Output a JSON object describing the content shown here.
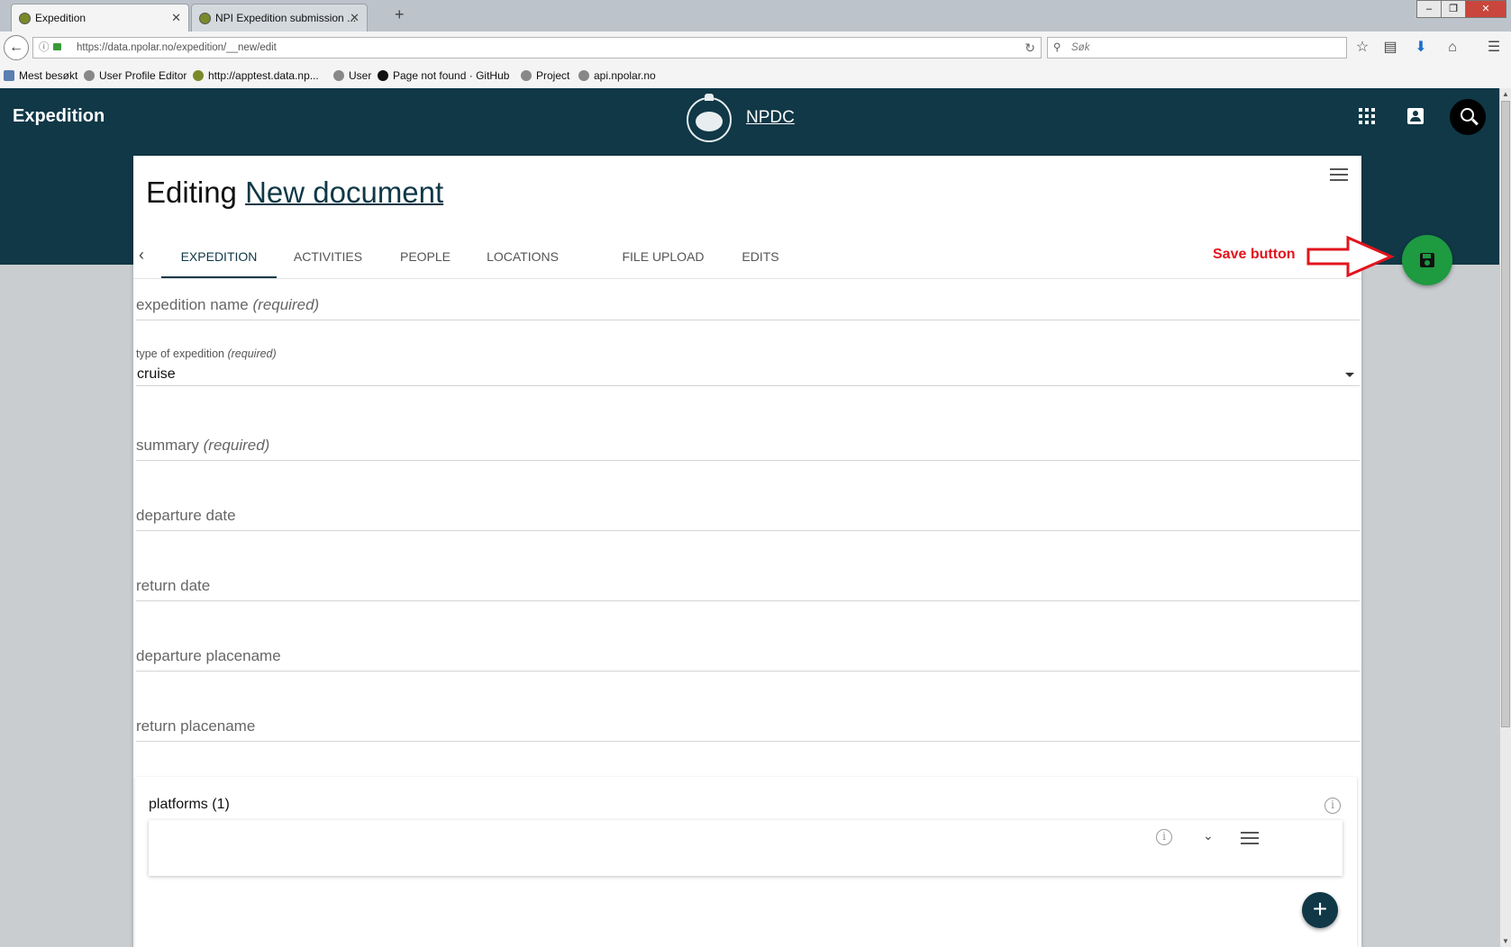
{
  "browser": {
    "tabs": [
      {
        "title": "Expedition",
        "active": true
      },
      {
        "title": "NPI Expedition submission ...",
        "active": false
      }
    ],
    "url": "https://data.npolar.no/expedition/__new/edit",
    "search_placeholder": "Søk",
    "bookmarks": [
      "Mest besøkt",
      "User Profile Editor",
      "http://apptest.data.np...",
      "User",
      "Page not found · GitHub",
      "Project",
      "api.npolar.no"
    ]
  },
  "app": {
    "title": "Expedition",
    "brand": "NPDC",
    "colors": {
      "header": "#103847",
      "save": "#1e9a40",
      "annotation": "#e3141c"
    }
  },
  "editor": {
    "heading_prefix": "Editing",
    "heading_link": "New document",
    "tabs": [
      "EXPEDITION",
      "ACTIVITIES",
      "PEOPLE",
      "LOCATIONS",
      "FILE UPLOAD",
      "EDITS"
    ],
    "active_tab": "EXPEDITION",
    "fields": {
      "expedition_name": {
        "label": "expedition name",
        "req": "(required)"
      },
      "type_of_expedition": {
        "label": "type of expedition",
        "req": "(required)",
        "value": "cruise"
      },
      "summary": {
        "label": "summary",
        "req": "(required)"
      },
      "departure_date": {
        "label": "departure date"
      },
      "return_date": {
        "label": "return date"
      },
      "departure_placename": {
        "label": "departure placename"
      },
      "return_placename": {
        "label": "return placename"
      }
    },
    "platforms": {
      "title": "platforms (1)"
    }
  },
  "annotation": {
    "text": "Save button"
  }
}
